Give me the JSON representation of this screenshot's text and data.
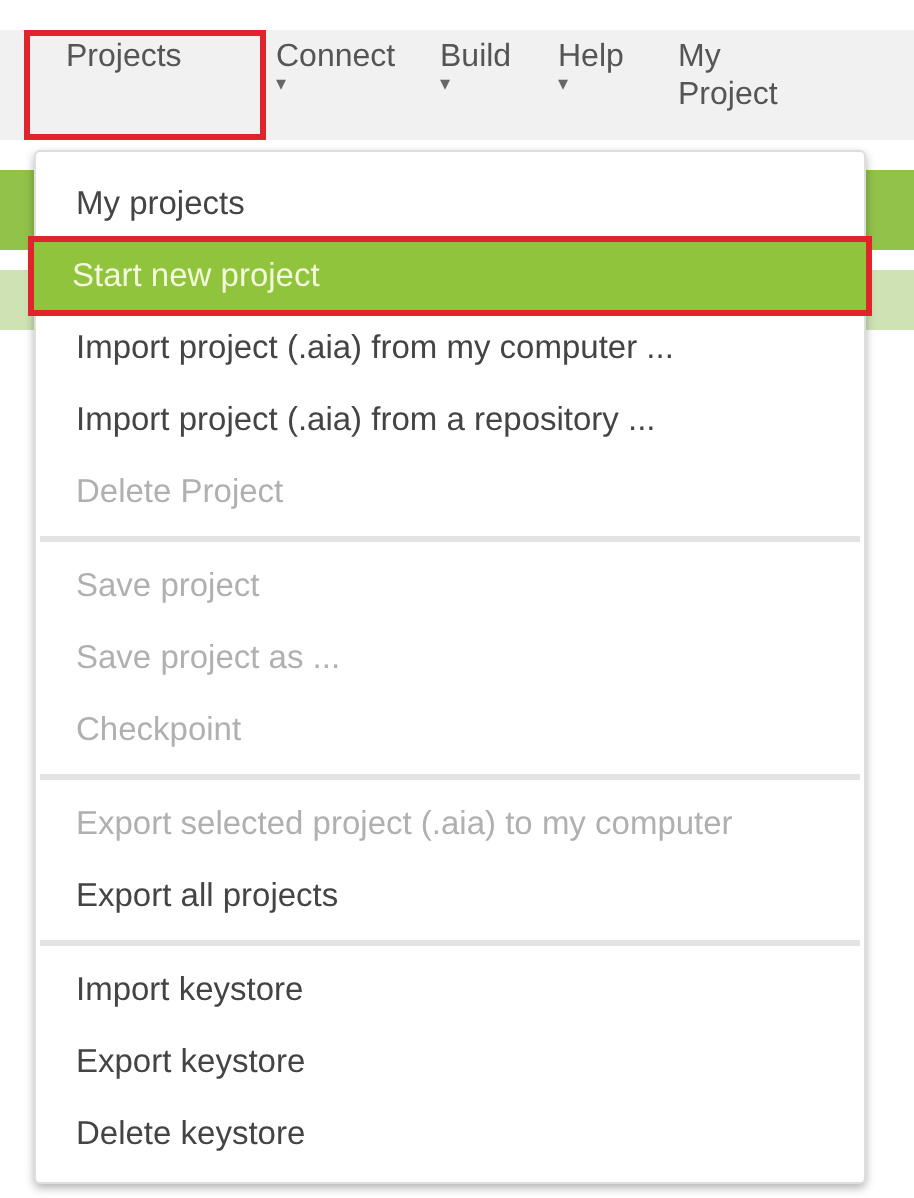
{
  "menubar": [
    {
      "label": "Projects",
      "highlighted": true
    },
    {
      "label": "Connect",
      "caret": "▾",
      "highlighted": false
    },
    {
      "label": "Build",
      "caret": "▾",
      "highlighted": false
    },
    {
      "label": "Help",
      "caret": "▾",
      "highlighted": false
    },
    {
      "label": "My Project",
      "highlighted": false
    }
  ],
  "menu": [
    {
      "kind": "item",
      "label": "My projects",
      "disabled": false,
      "selected": false,
      "highlighted": false
    },
    {
      "kind": "item",
      "label": "Start new project",
      "disabled": false,
      "selected": true,
      "highlighted": true
    },
    {
      "kind": "item",
      "label": "Import project (.aia) from my computer ...",
      "disabled": false,
      "selected": false,
      "highlighted": false
    },
    {
      "kind": "item",
      "label": "Import project (.aia) from a repository ...",
      "disabled": false,
      "selected": false,
      "highlighted": false
    },
    {
      "kind": "item",
      "label": "Delete Project",
      "disabled": true,
      "selected": false,
      "highlighted": false
    },
    {
      "kind": "divider"
    },
    {
      "kind": "item",
      "label": "Save project",
      "disabled": true,
      "selected": false,
      "highlighted": false
    },
    {
      "kind": "item",
      "label": "Save project as ...",
      "disabled": true,
      "selected": false,
      "highlighted": false
    },
    {
      "kind": "item",
      "label": "Checkpoint",
      "disabled": true,
      "selected": false,
      "highlighted": false
    },
    {
      "kind": "divider"
    },
    {
      "kind": "item",
      "label": "Export selected project (.aia) to my computer",
      "disabled": true,
      "selected": false,
      "highlighted": false
    },
    {
      "kind": "item",
      "label": "Export all projects",
      "disabled": false,
      "selected": false,
      "highlighted": false
    },
    {
      "kind": "divider"
    },
    {
      "kind": "item",
      "label": "Import keystore",
      "disabled": false,
      "selected": false,
      "highlighted": false
    },
    {
      "kind": "item",
      "label": "Export keystore",
      "disabled": false,
      "selected": false,
      "highlighted": false
    },
    {
      "kind": "item",
      "label": "Delete keystore",
      "disabled": false,
      "selected": false,
      "highlighted": false
    }
  ]
}
